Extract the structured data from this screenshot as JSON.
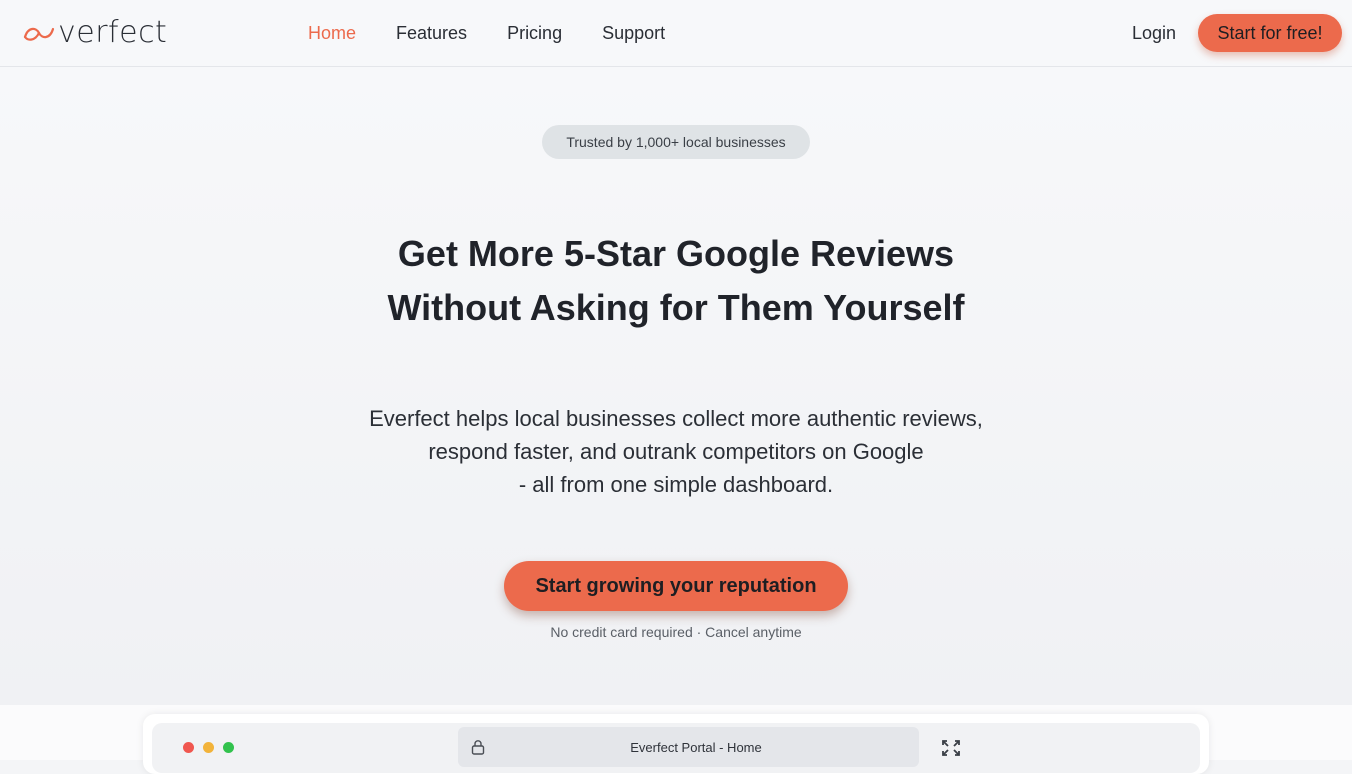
{
  "header": {
    "logo_text": "verfect",
    "nav": [
      {
        "label": "Home",
        "active": true
      },
      {
        "label": "Features",
        "active": false
      },
      {
        "label": "Pricing",
        "active": false
      },
      {
        "label": "Support",
        "active": false
      }
    ],
    "login_label": "Login",
    "cta_label": "Start for free!"
  },
  "hero": {
    "badge": "Trusted by 1,000+ local businesses",
    "headline_line1": "Get More 5-Star Google Reviews",
    "headline_line2": "Without Asking for Them Yourself",
    "sub_line1": "Everfect helps local businesses collect more authentic reviews,",
    "sub_line2": "respond faster, and outrank competitors on Google",
    "sub_line3": "- all from one simple dashboard.",
    "cta_label": "Start growing your reputation",
    "cta_note": "No credit card required · Cancel anytime"
  },
  "preview": {
    "address_text": "Everfect Portal - Home",
    "icons": [
      "lock-icon",
      "expand-icon"
    ]
  },
  "colors": {
    "accent": "#ec6a4c",
    "text": "#20232a",
    "background": "#f4f5f7"
  }
}
